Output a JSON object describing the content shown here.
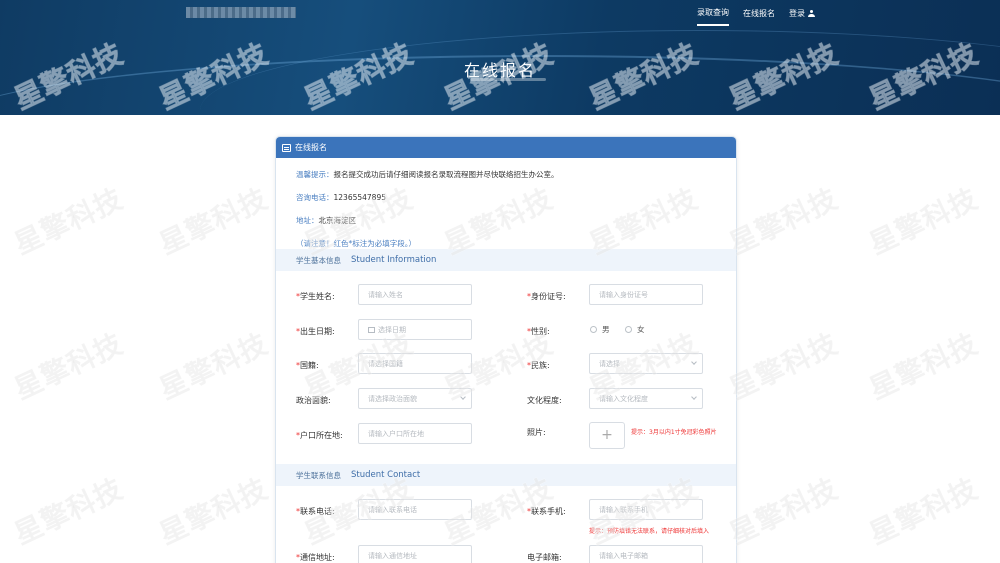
{
  "nav": {
    "items": [
      "录取查询",
      "在线报名",
      "登录"
    ],
    "active_index": 0
  },
  "banner": {
    "title": "在线报名"
  },
  "card": {
    "header": "在线报名",
    "info": {
      "tip_label": "温馨提示：",
      "tip_text": "报名提交成功后请仔细阅读报名录取流程图并尽快联络招生办公室。",
      "phone_label": "咨询电话：",
      "phone_value": "12365547895",
      "address_label": "地址：",
      "address_value": "北京海淀区",
      "required_note": "（请注意！红色*标注为必填字段。）"
    },
    "section_basic": {
      "cn": "学生基本信息",
      "en": "Student Information"
    },
    "section_contact": {
      "cn": "学生联系信息",
      "en": "Student Contact"
    },
    "fields": {
      "name": {
        "label": "学生姓名:",
        "placeholder": "请输入姓名"
      },
      "id_number": {
        "label": "身份证号:",
        "placeholder": "请输入身份证号"
      },
      "birth": {
        "label": "出生日期:",
        "placeholder": "选择日期"
      },
      "gender": {
        "label": "性别:",
        "options": [
          "男",
          "女"
        ]
      },
      "nationality": {
        "label": "国籍:",
        "placeholder": "请选择国籍"
      },
      "ethnicity": {
        "label": "民族:",
        "placeholder": "请选择"
      },
      "political": {
        "label": "政治面貌:",
        "placeholder": "请选择政治面貌"
      },
      "education": {
        "label": "文化程度:",
        "placeholder": "请输入文化程度"
      },
      "hukou": {
        "label": "户口所在地:",
        "placeholder": "请输入户口所在地"
      },
      "photo": {
        "label": "照片:",
        "tip": "提示：3月以内1寸免冠彩色照片"
      },
      "contact_phone": {
        "label": "联系电话:",
        "placeholder": "请输入联系电话"
      },
      "mobile": {
        "label": "联系手机:",
        "placeholder": "请输入联系手机",
        "tip": "提示：预防填错无法联系，请仔细核对后填入"
      },
      "mail_address": {
        "label": "通信地址:",
        "placeholder": "请输入通信地址"
      },
      "email": {
        "label": "电子邮箱:",
        "placeholder": "请输入电子邮箱"
      }
    }
  },
  "watermark": "星擎科技",
  "icons": {
    "user": "user-icon",
    "form": "form-icon",
    "select": "chevron-down-icon",
    "date": "calendar-icon",
    "upload": "plus-icon"
  },
  "colors": {
    "banner": "#0f3b63",
    "header": "#3b74bb",
    "required": "#ee3333",
    "accent_text": "#4a7fc1"
  }
}
